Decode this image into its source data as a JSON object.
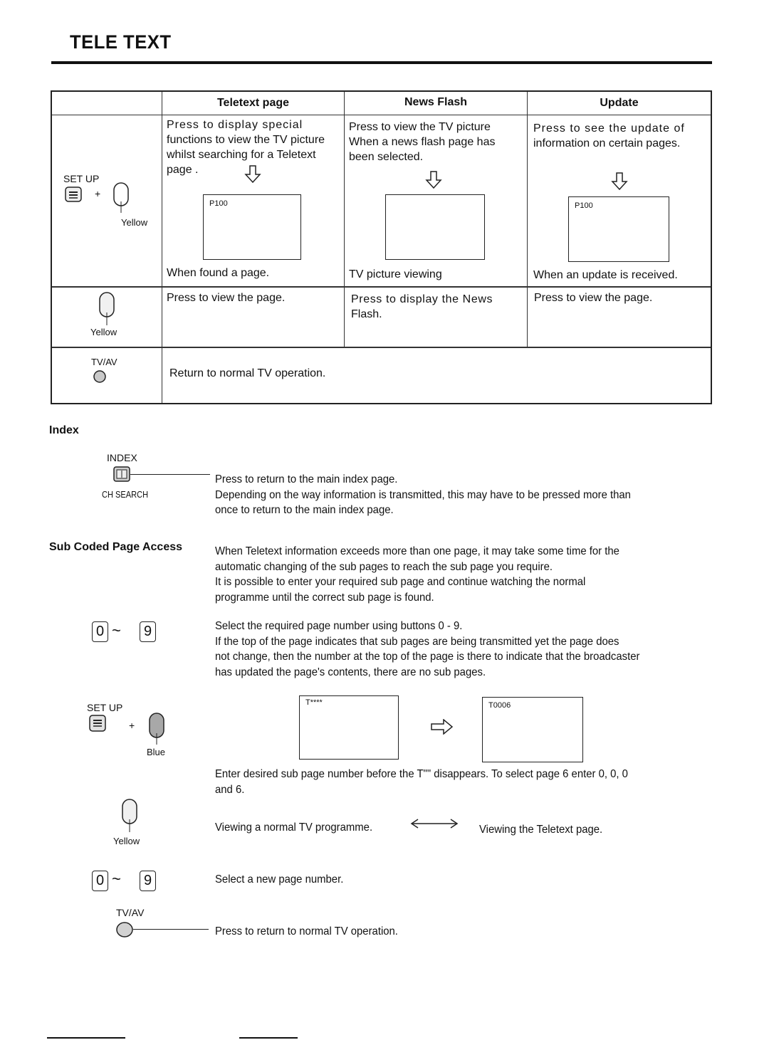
{
  "page": {
    "title": "TELE TEXT"
  },
  "table": {
    "headers": [
      "",
      "Teletext page",
      "News Flash",
      "Update"
    ],
    "row1": {
      "icon_label_top": "SET UP",
      "icon_label_bottom": "Yellow",
      "plus": "+",
      "teletext_page": {
        "lines": [
          "Press  to display special",
          "functions to view the TV picture",
          "whilst searching for a Teletext",
          "page ."
        ],
        "screen_label": "P100",
        "caption": "When found a page."
      },
      "news_flash": {
        "lines": [
          "Press to view the TV picture",
          "When a news flash page has",
          "been selected."
        ],
        "screen_label": "",
        "caption": "TV picture viewing"
      },
      "update": {
        "lines": [
          "Press  to see the update of",
          "information on certain pages."
        ],
        "screen_label": "P100",
        "caption": "When an update is received."
      }
    },
    "row2": {
      "icon_label": "Yellow",
      "teletext_page": "Press to view the page.",
      "news_flash_lines": [
        "Press to display the News",
        "Flash."
      ],
      "update": "Press to view the page."
    },
    "row3": {
      "icon_label": "TV/AV",
      "text": "Return to normal TV operation."
    }
  },
  "index": {
    "heading": "Index",
    "button_label_top": "INDEX",
    "button_label_bottom": "CH SEARCH",
    "lines": [
      "Press  to return to the main index page.",
      "Depending on the way information is transmitted, this may have to be pressed more than",
      "once to return to the main index page."
    ]
  },
  "sub_coded": {
    "heading": "Sub Coded Page Access",
    "intro_lines": [
      "When Teletext information exceeds more than one page, it may take some time for the",
      "automatic changing of the sub pages to reach the sub page you require.",
      "It is possible to enter your required sub page and continue watching the normal",
      "programme until the correct sub page is found."
    ],
    "keys": {
      "first": "0",
      "last": "9",
      "separator": "~"
    },
    "select_lines": [
      "Select the required page number using buttons 0 - 9.",
      "If the top of the page indicates that sub pages are being transmitted yet the page does",
      "not change, then the number at the top of the page is there to indicate that the broadcaster",
      "has updated the page's contents, there are no sub pages."
    ],
    "setup_blue": {
      "label_top": "SET UP",
      "label_bottom": "Blue",
      "plus": "+"
    },
    "screen_before": "T****",
    "screen_after": "T0006",
    "enter_lines": [
      "Enter desired sub page number before the T\"\" disappears. To select page 6 enter 0, 0, 0",
      "and 6."
    ],
    "yellow_label": "Yellow",
    "toggle_left": "Viewing a normal TV programme.",
    "toggle_right": "Viewing the Teletext page.",
    "new_page_text": "Select a new page number.",
    "tvav_label": "TV/AV",
    "tvav_text": "Press to return to normal TV operation."
  }
}
